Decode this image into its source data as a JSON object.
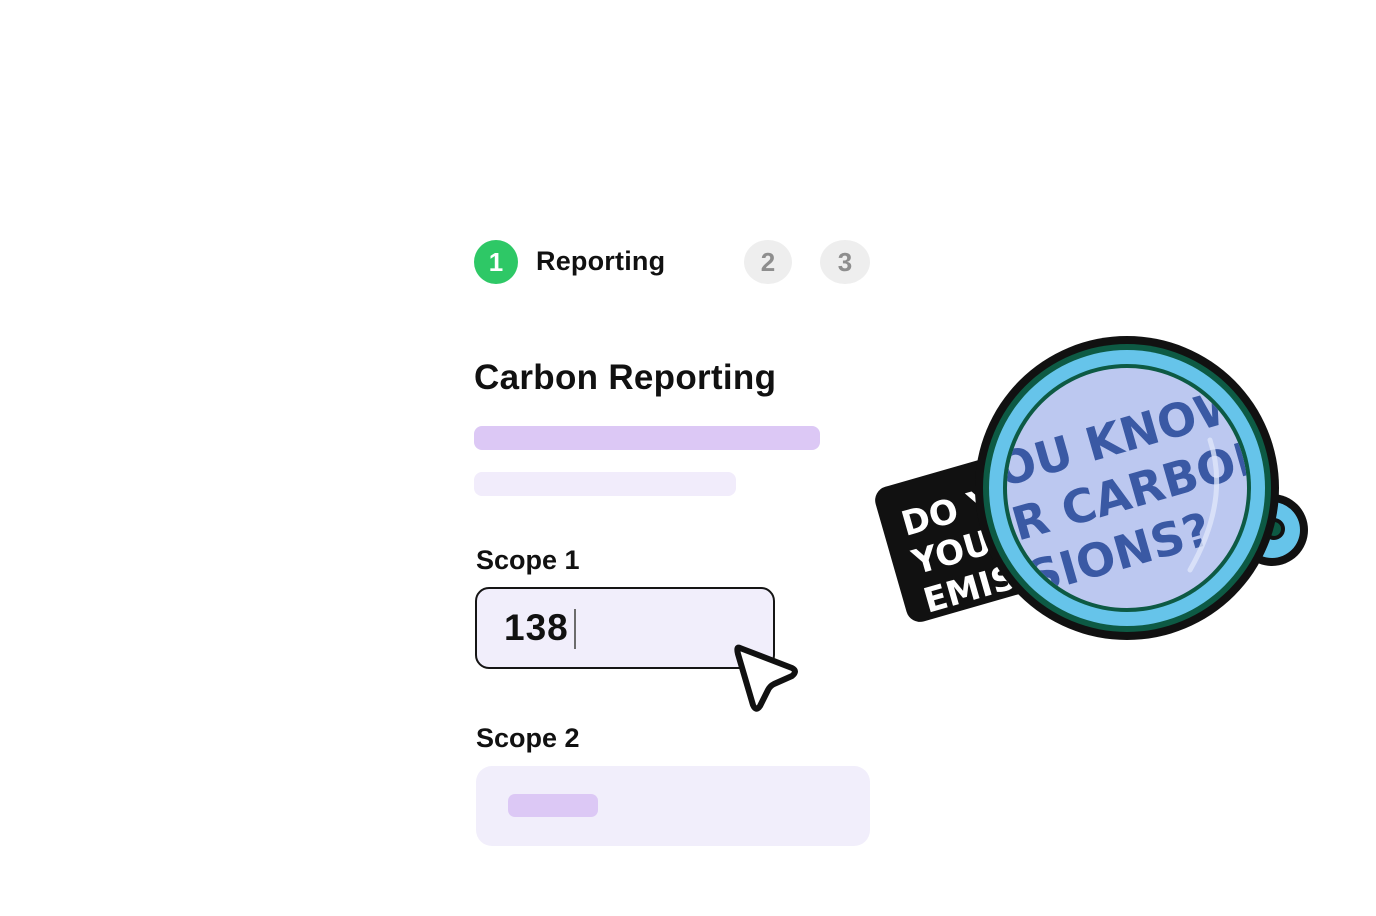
{
  "stepper": {
    "steps": [
      {
        "number": "1",
        "label": "Reporting",
        "state": "active"
      },
      {
        "number": "2",
        "state": "upcoming"
      },
      {
        "number": "3",
        "state": "upcoming"
      }
    ]
  },
  "page": {
    "title": "Carbon Reporting"
  },
  "form": {
    "scope1": {
      "label": "Scope 1",
      "value": "138"
    },
    "scope2": {
      "label": "Scope 2",
      "value": ""
    }
  },
  "sticker": {
    "label_text": [
      "DO Y",
      "YOU",
      "EMIS"
    ],
    "magnified_text": [
      "OU KNOW",
      "R CARBON",
      "SIONS?"
    ]
  },
  "colors": {
    "accent_green": "#2ec866",
    "lavender": "#dcc8f5",
    "field_bg": "#f1eefb",
    "lens_fill": "#bcc8f0",
    "lens_ring": "#66c4ea",
    "lens_text": "#3a59a4"
  },
  "icons": [
    "pointer-cursor-icon",
    "magnifying-glass-icon"
  ]
}
